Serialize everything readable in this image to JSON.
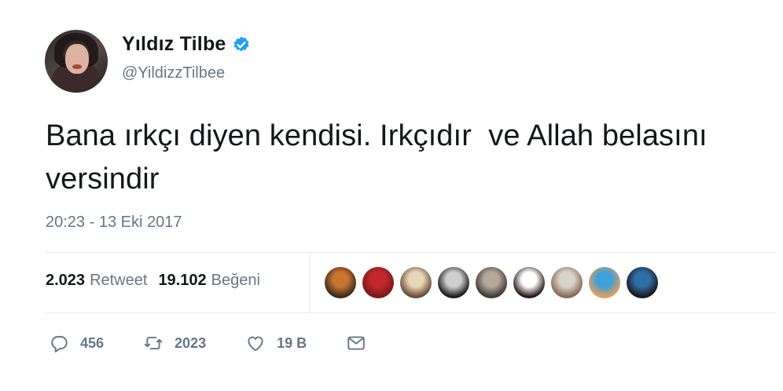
{
  "user": {
    "display_name": "Yıldız Tilbe",
    "handle": "@YildizzTilbee",
    "verified": true,
    "avatar_icon": "profile-photo"
  },
  "tweet": {
    "text": "Bana ırkçı diyen kendisi. Irkçıdır  ve Allah belasını versindir",
    "timestamp": "20:23 - 13 Eki 2017"
  },
  "stats": {
    "retweets_count": "2.023",
    "retweets_label": "Retweet",
    "likes_count": "19.102",
    "likes_label": "Beğeni"
  },
  "likers": [
    {
      "name": "liker-avatar-1",
      "colors": [
        "#c9742f",
        "#3b2a1f"
      ]
    },
    {
      "name": "liker-avatar-2",
      "colors": [
        "#c2272d",
        "#7a1a1a"
      ]
    },
    {
      "name": "liker-avatar-3",
      "colors": [
        "#e7d6b8",
        "#6b4e3a"
      ]
    },
    {
      "name": "liker-avatar-4",
      "colors": [
        "#cfcfcf",
        "#1c1c1c"
      ]
    },
    {
      "name": "liker-avatar-5",
      "colors": [
        "#b7a89a",
        "#3e3a36"
      ]
    },
    {
      "name": "liker-avatar-6",
      "colors": [
        "#ffffff",
        "#2a1a1a"
      ]
    },
    {
      "name": "liker-avatar-7",
      "colors": [
        "#d9d4c8",
        "#8a6a5a"
      ]
    },
    {
      "name": "liker-avatar-8",
      "colors": [
        "#3ea0d8",
        "#e0a060"
      ]
    },
    {
      "name": "liker-avatar-9",
      "colors": [
        "#2e6fa8",
        "#1a1a1a"
      ]
    }
  ],
  "actions": {
    "reply_count": "456",
    "retweet_count": "2023",
    "like_count": "19 B",
    "icons": [
      "reply-icon",
      "retweet-icon",
      "heart-icon",
      "message-icon"
    ]
  },
  "colors": {
    "verified_blue": "#1da1f2",
    "secondary_text": "#657786",
    "divider": "#e6ecf0"
  }
}
